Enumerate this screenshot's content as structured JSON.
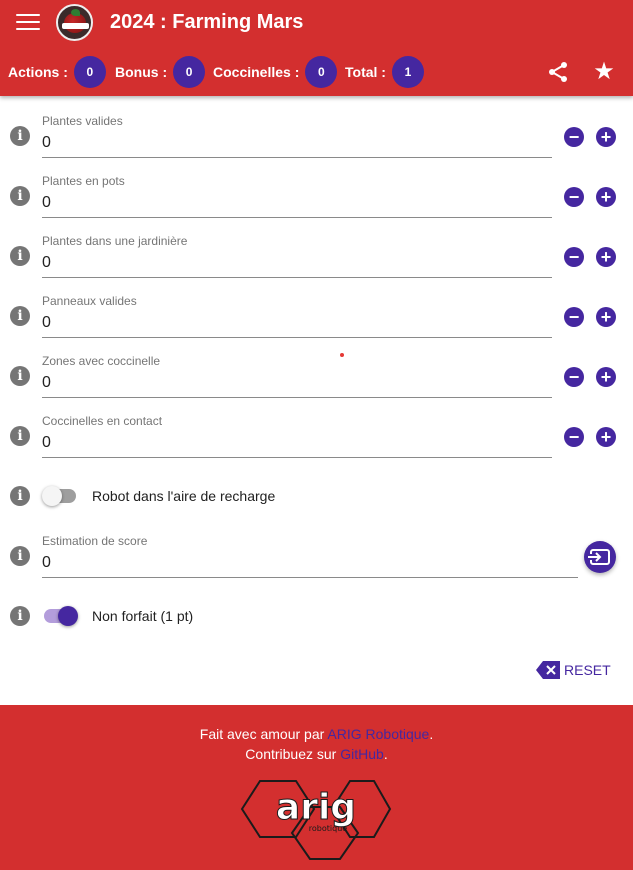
{
  "app": {
    "title": "2024 : Farming Mars"
  },
  "counters": [
    {
      "label": "Actions :",
      "value": "0"
    },
    {
      "label": "Bonus :",
      "value": "0"
    },
    {
      "label": "Coccinelles :",
      "value": "0"
    },
    {
      "label": "Total :",
      "value": "1"
    }
  ],
  "fields": [
    {
      "label": "Plantes valides",
      "value": "0"
    },
    {
      "label": "Plantes en pots",
      "value": "0"
    },
    {
      "label": "Plantes dans une jardinière",
      "value": "0"
    },
    {
      "label": "Panneaux valides",
      "value": "0"
    },
    {
      "label": "Zones avec coccinelle",
      "value": "0"
    },
    {
      "label": "Coccinelles en contact",
      "value": "0"
    }
  ],
  "toggles": {
    "recharge": {
      "label": "Robot dans l'aire de recharge",
      "on": false
    },
    "forfait": {
      "label": "Non forfait (1 pt)",
      "on": true
    }
  },
  "estimation": {
    "label": "Estimation de score",
    "value": "0"
  },
  "reset": {
    "label": "RESET"
  },
  "footer": {
    "line1_prefix": "Fait avec amour par ",
    "line1_link": "ARIG Robotique",
    "line1_suffix": ".",
    "line2_prefix": "Contribuez sur ",
    "line2_link": "GitHub",
    "line2_suffix": ".",
    "logo_text": "arig",
    "logo_subtext": "robotique"
  },
  "icons": {
    "menu": "menu-icon",
    "share": "share-icon",
    "star": "star-icon",
    "info": "info-icon",
    "minus": "remove-circle-icon",
    "plus": "add-circle-icon",
    "input": "input-icon",
    "clear": "backspace-icon"
  },
  "colors": {
    "primary": "#d32f2f",
    "accent": "#4527a0",
    "accent_light": "#b39ddb"
  }
}
